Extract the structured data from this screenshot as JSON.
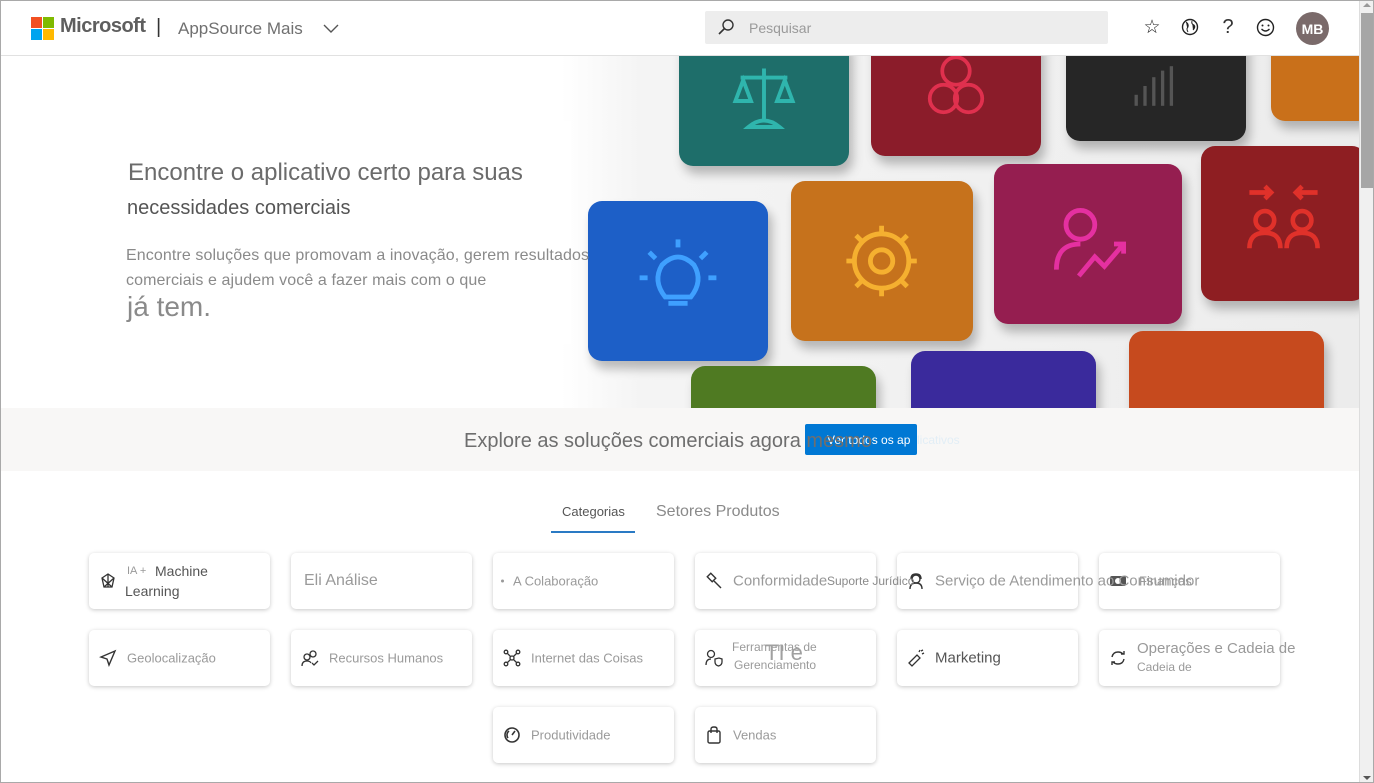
{
  "header": {
    "brand": "Microsoft",
    "separator": "|",
    "app_name": "AppSource Mais",
    "search_placeholder": "Pesquisar",
    "avatar_initials": "MB",
    "icons": [
      "star-icon",
      "globe-icon",
      "help-icon",
      "smiley-icon"
    ],
    "logo_colors": [
      "#f25022",
      "#7fba00",
      "#00a4ef",
      "#ffb900"
    ]
  },
  "hero": {
    "title_line1": "Encontre o aplicativo certo para suas",
    "title_line2": "necessidades comerciais",
    "description": "Encontre soluções que promovam a inovação, gerem resultados comerciais e ajudem você a fazer mais com o que",
    "description_end": "já tem."
  },
  "explore": {
    "text": "Explore as soluções comerciais agora mesmo",
    "button_label": "Ver todos os ap",
    "button_overflow": "licativos",
    "button_color": "#0078d4"
  },
  "tabs": {
    "categories": "Categorias",
    "sectors_products": "Setores Produtos"
  },
  "categories": [
    {
      "prefix": "IA +",
      "label": "Machine",
      "label2": "Learning",
      "icon": "ai-network-icon"
    },
    {
      "label": "Eli Análise",
      "icon": "none"
    },
    {
      "label": "A Colaboração",
      "icon": "dot-icon"
    },
    {
      "label": "Conformidade",
      "overflow": "Suporte Jurídico",
      "icon": "gavel-icon"
    },
    {
      "label": "Serviço de Atendimento ao Consumidor",
      "icon": "headset-icon"
    },
    {
      "label": "Finanças",
      "icon": "money-icon"
    },
    {
      "label": "Geolocalização",
      "icon": "location-arrow-icon"
    },
    {
      "label": "Recursos Humanos",
      "icon": "people-check-icon"
    },
    {
      "label": "Internet das Coisas",
      "icon": "iot-hub-icon"
    },
    {
      "label": "Ferramentas de",
      "label2": "Gerenciamento",
      "overflow": "TI e",
      "icon": "person-shield-icon"
    },
    {
      "label": "Marketing",
      "icon": "megaphone-icon"
    },
    {
      "label": "Operações e Cadeia de",
      "label2": "Cadeia de",
      "icon": "sync-icon"
    },
    {
      "label": "Produtividade",
      "icon": "gauge-icon"
    },
    {
      "label": "Vendas",
      "icon": "shopping-bag-icon"
    }
  ]
}
